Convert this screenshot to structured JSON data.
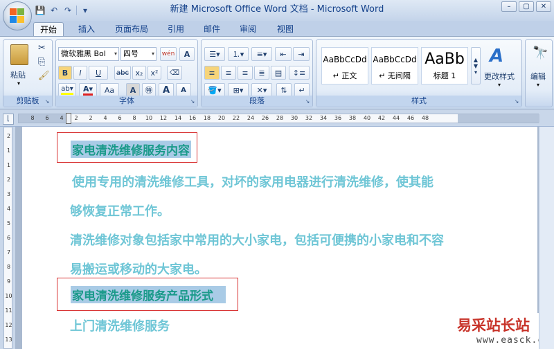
{
  "window": {
    "title": "新建 Microsoft Office Word 文档 - Microsoft Word",
    "controls": [
      "–",
      "▢",
      "✕"
    ]
  },
  "qat": [
    "💾",
    "↶",
    "↷"
  ],
  "tabs": [
    "开始",
    "插入",
    "页面布局",
    "引用",
    "邮件",
    "审阅",
    "视图"
  ],
  "ribbon": {
    "clipboard": {
      "paste": "粘贴",
      "label": "剪贴板"
    },
    "font": {
      "name": "微软雅黑 Bol",
      "size": "四号",
      "label": "字体",
      "bold": "B",
      "italic": "I",
      "underline": "U",
      "strike": "abc",
      "sub": "x₂",
      "sup": "x²",
      "grow": "A",
      "shrink": "A",
      "aa": "Aa",
      "clear": "A"
    },
    "paragraph": {
      "label": "段落"
    },
    "styles": {
      "label": "样式",
      "items": [
        {
          "preview": "AaBbCcDd",
          "name": "↵ 正文"
        },
        {
          "preview": "AaBbCcDd",
          "name": "↵ 无间隔"
        },
        {
          "preview": "AaBb",
          "name": "标题 1"
        }
      ],
      "change": "更改样式"
    },
    "editing": {
      "label": "编辑"
    }
  },
  "ruler": {
    "ticks": [
      "8",
      "6",
      "4",
      "2",
      "2",
      "4",
      "6",
      "8",
      "10",
      "12",
      "14",
      "16",
      "18",
      "20",
      "22",
      "24",
      "26",
      "28",
      "30",
      "32",
      "34",
      "36",
      "38",
      "40",
      "42",
      "44",
      "46",
      "48"
    ],
    "vticks": [
      "2",
      "1",
      "1",
      "2",
      "3",
      "4",
      "5",
      "6",
      "7",
      "8",
      "9",
      "10",
      "11",
      "12",
      "13"
    ]
  },
  "document": {
    "heading1": "家电清洗维修服务内容",
    "para1_line1": "使用专用的清洗维修工具，对坏的家用电器进行清洗维修，使其能",
    "para1_line2": "够恢复正常工作。",
    "para2_line1": "清洗维修对象包括家中常用的大小家电，包括可便携的小家电和不容",
    "para2_line2": "易搬运或移动的大家电。",
    "heading2": "家电清洗维修服务产品形式",
    "para3_line1": "上门清洗维修服务"
  },
  "watermark": {
    "cn": "易采站长站",
    "url": "www.easck.com"
  }
}
